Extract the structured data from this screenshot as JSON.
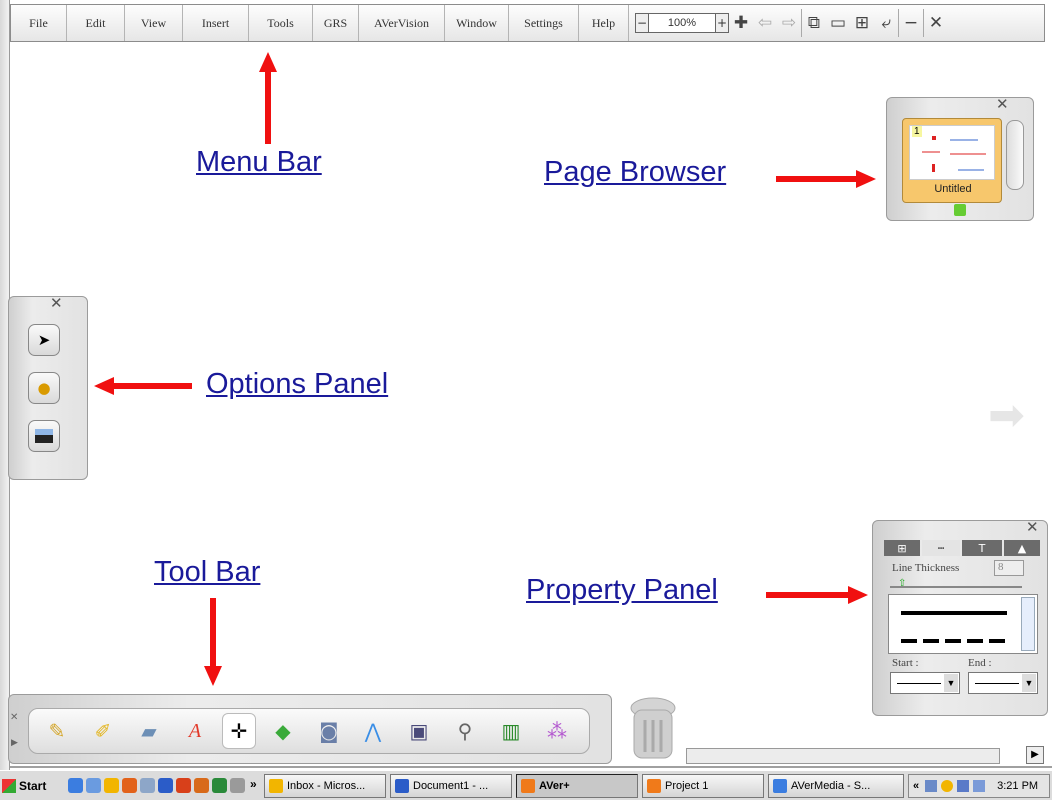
{
  "menu_bar": {
    "items": [
      "File",
      "Edit",
      "View",
      "Insert",
      "Tools",
      "GRS",
      "AVerVision",
      "Window",
      "Settings",
      "Help"
    ],
    "zoom_value": "100%",
    "icons": [
      "zoom-in-icon",
      "back-arrow-icon",
      "forward-arrow-icon",
      "window-icon",
      "monitor-icon",
      "grid-icon",
      "undo-icon",
      "minimize-icon",
      "close-icon"
    ]
  },
  "annotations": {
    "menu_bar": "Menu Bar",
    "page_browser": "Page Browser",
    "options_panel": "Options Panel",
    "tool_bar": "Tool Bar",
    "property_panel": "Property Panel"
  },
  "page_browser": {
    "page_number": "1",
    "page_name": "Untitled"
  },
  "options_panel": {
    "buttons": [
      "pointer-move-icon",
      "flashlight-icon",
      "screen-shade-icon"
    ]
  },
  "property_panel": {
    "tabs": [
      "grid-tab-icon",
      "line-style-tab-icon",
      "text-tab-icon",
      "shape-tab-icon"
    ],
    "line_thickness_label": "Line Thickness",
    "line_thickness_value": "8",
    "start_label": "Start :",
    "end_label": "End :"
  },
  "tool_bar": {
    "tools": [
      "pen-icon",
      "highlighter-icon",
      "eraser-icon",
      "text-icon",
      "move-icon",
      "shapes-icon",
      "camera-capture-icon",
      "line-icon",
      "photo-icon",
      "document-camera-icon",
      "chart-icon",
      "gallery-icon"
    ]
  },
  "taskbar": {
    "start_label": "start",
    "overflow_label": "»",
    "tasks": [
      "Inbox - Micros...",
      "Document1 - ...",
      "AVer+",
      "Project 1",
      "AVerMedia - S..."
    ],
    "tray_expand": "«",
    "time": "3:21 PM"
  },
  "colors": {
    "annotation_text": "#1a1a9a",
    "arrow": "#f01010",
    "page_thumb": "#f7c76c"
  }
}
